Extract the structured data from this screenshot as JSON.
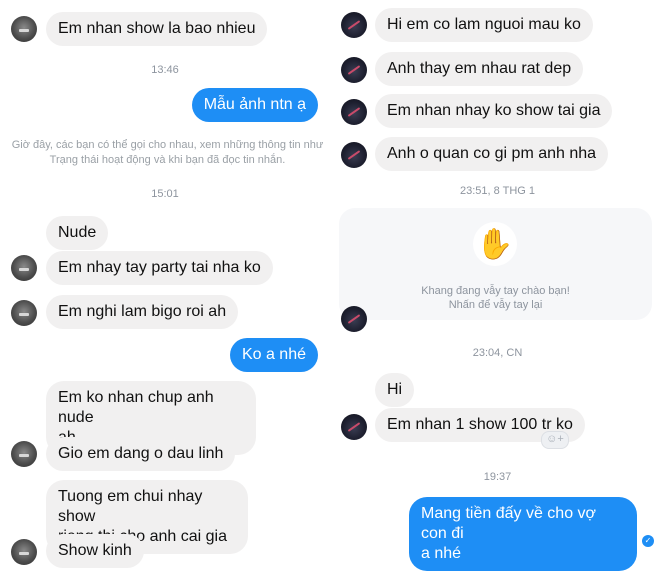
{
  "left": {
    "msg1": "Em nhan show la bao nhieu",
    "time1": "13:46",
    "msg2": "Mẫu ảnh ntn ạ",
    "system_notice": "Giờ đây, các bạn có thể gọi cho nhau, xem những thông tin như Trạng thái hoạt động và khi bạn đã đọc tin nhắn.",
    "time2": "15:01",
    "msg3": "Nude",
    "msg4": "Em nhay tay party tai nha ko",
    "msg5": "Em nghi lam bigo roi ah",
    "msg6": "Ko a nhé",
    "msg7": "Em ko nhan chup anh nude\nah",
    "msg8": "Gio em dang o dau linh",
    "msg9": "Tuong em chui nhay show\nrieng thi cho anh cai gia",
    "msg10": "Show kinh"
  },
  "right": {
    "msg1": "Hi em co lam nguoi mau ko",
    "msg2": "Anh thay em nhau rat dep",
    "msg3": "Em nhan nhay ko show tai gia",
    "msg4": "Anh o quan co gi pm anh nha",
    "time1": "23:51, 8 THG 1",
    "wave_line1": "Khang đang vẫy tay chào bạn!",
    "wave_line2": "Nhấn để vẫy tay lại",
    "wave_emoji": "✋",
    "time2": "23:04, CN",
    "msg5": "Hi",
    "msg6": "Em nhan 1 show 100 tr ko",
    "react_icon": "☺+",
    "time3": "19:37",
    "msg7": "Mang tiền đấy về cho vợ con đi\na nhé",
    "seen_icon": "✓"
  }
}
